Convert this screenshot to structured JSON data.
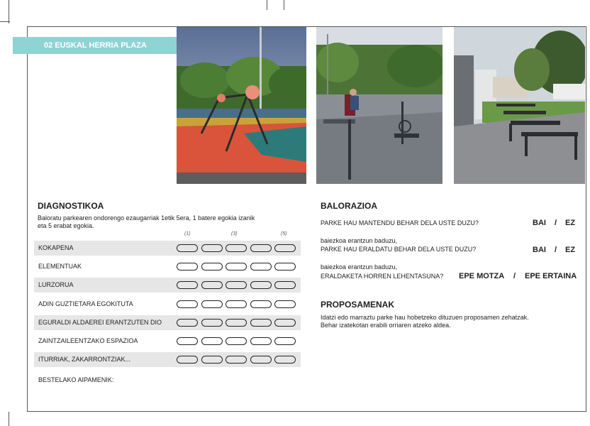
{
  "banner": {
    "title": "02 EUSKAL HERRIA PLAZA"
  },
  "photos": {
    "playground": "playground-photo",
    "fitness": "outdoor-fitness-photo",
    "benches": "benches-photo"
  },
  "diagnostikoa": {
    "title": "DIAGNOSTIKOA",
    "instructions_line1": "Baloratu parkearen ondorengo ezaugarriak 1etik 5era, 1 batere egokia izanik",
    "instructions_line2": "eta 5 erabat egokia.",
    "scale": [
      "(1)",
      "(3)",
      "(5)"
    ],
    "rows": [
      "KOKAPENA",
      "ELEMENTUAK",
      "LURZORUA",
      "ADIN GUZTIETARA EGOKITUTA",
      "EGURALDI ALDAEREI ERANTZUTEN DIO",
      "ZAINTZAILEENTZAKO ESPAZIOA",
      "ITURRIAK, ZAKARRONTZIAK..."
    ],
    "other_comments": "BESTELAKO AIPAMENIK:"
  },
  "balorazioa": {
    "title": "BALORAZIOA",
    "q1": "PARKE HAU MANTENDU BEHAR DELA USTE DUZU?",
    "q2_prefix": "baiezkoa erantzun baduzu,",
    "q2": "PARKE HAU ERALDATU BEHAR DELA USTE DUZU?",
    "q3_prefix": "baiezkoa erantzun baduzu,",
    "q3": "ERALDAKETA HORREN LEHENTASUNA?",
    "yes": "BAI",
    "no": "EZ",
    "separator": "/",
    "short_term": "EPE MOTZA",
    "long_term": "EPE ERTAINA"
  },
  "proposamenak": {
    "title": "PROPOSAMENAK",
    "line1": "Idatzi edo marraztu parke hau hobetzeko dituzuen proposamen zehatzak.",
    "line2": "Behar izatekotan erabili orriaren atzeko aldea."
  },
  "colors": {
    "banner": "#8fd3d4",
    "row_shade": "#e6e6e6"
  }
}
